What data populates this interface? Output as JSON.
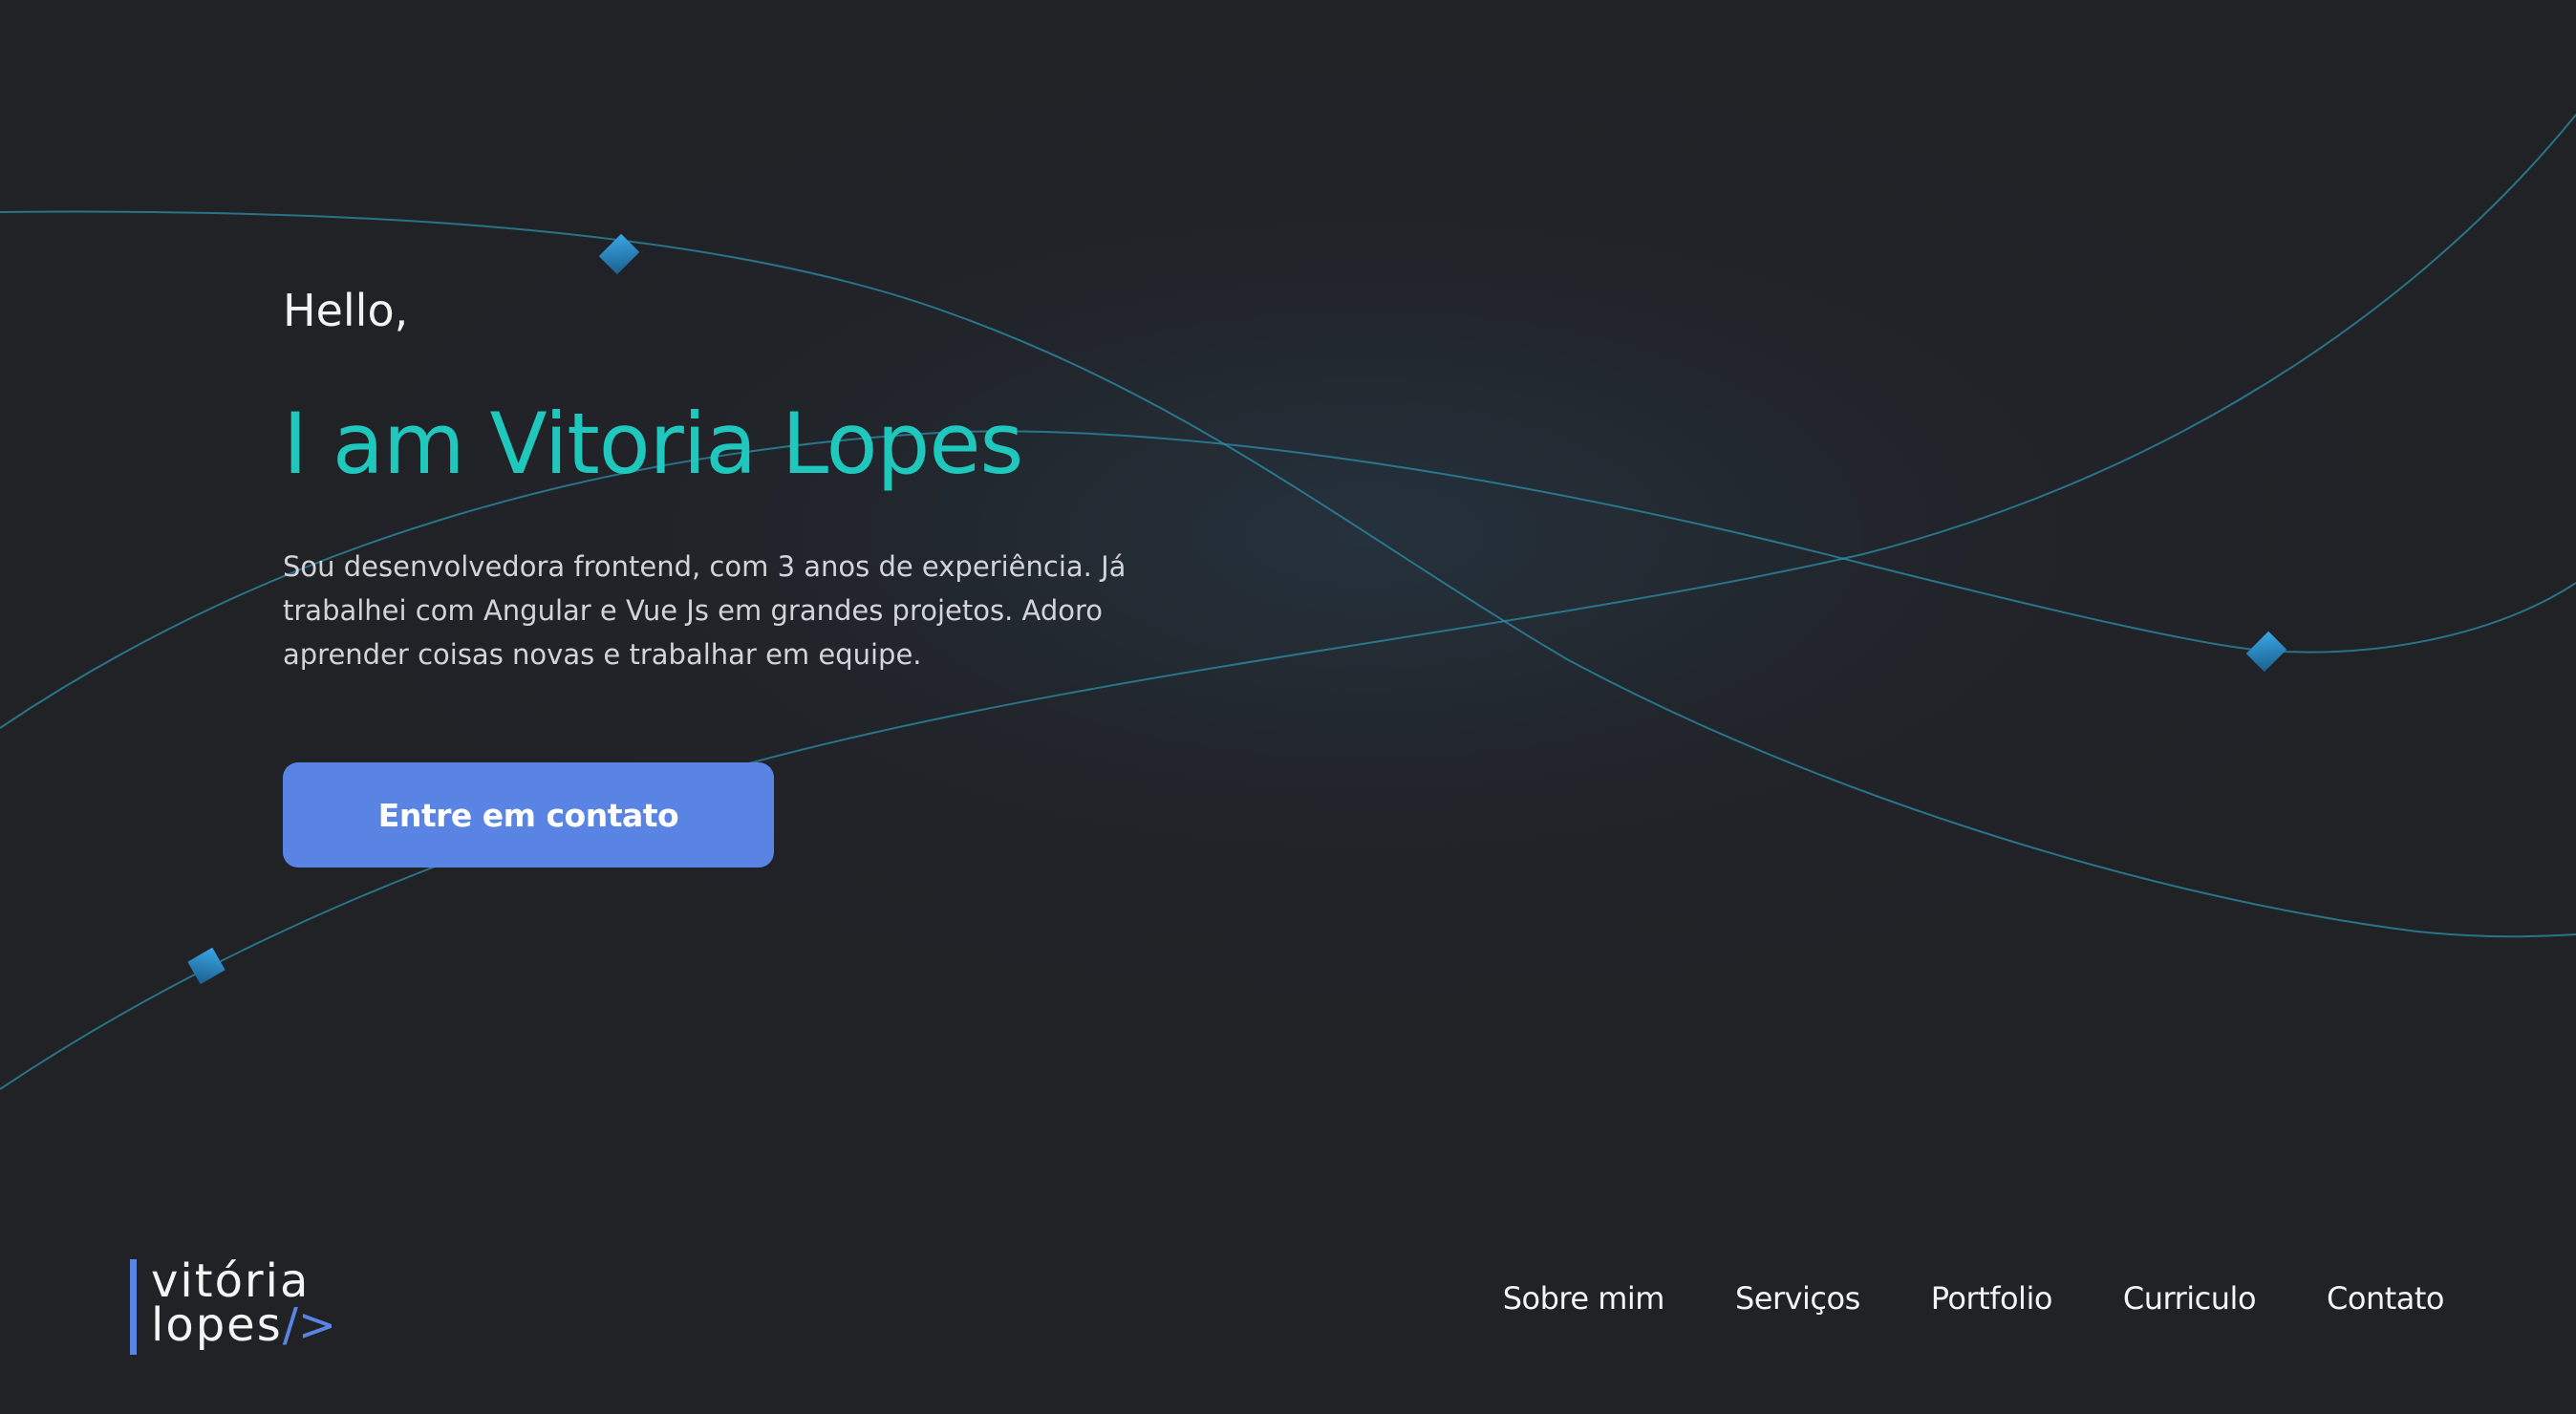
{
  "hero": {
    "greeting": "Hello,",
    "title": "I am Vitoria Lopes",
    "description": "Sou desenvolvedora frontend, com 3 anos de experiência. Já trabalhei com Angular e Vue Js em grandes projetos. Adoro aprender coisas novas e trabalhar em equipe.",
    "cta_label": "Entre em contato"
  },
  "logo": {
    "line1": "vitória",
    "line2": "lopes",
    "tag": "/>"
  },
  "nav": {
    "items": [
      {
        "label": "Sobre mim"
      },
      {
        "label": "Serviços"
      },
      {
        "label": "Portfolio"
      },
      {
        "label": "Curriculo"
      },
      {
        "label": "Contato"
      }
    ]
  },
  "colors": {
    "background": "#212226",
    "accent_teal": "#1fc7bd",
    "accent_blue": "#5a84e4",
    "line_color": "#2b8fa8",
    "text": "#f2f2f2"
  }
}
